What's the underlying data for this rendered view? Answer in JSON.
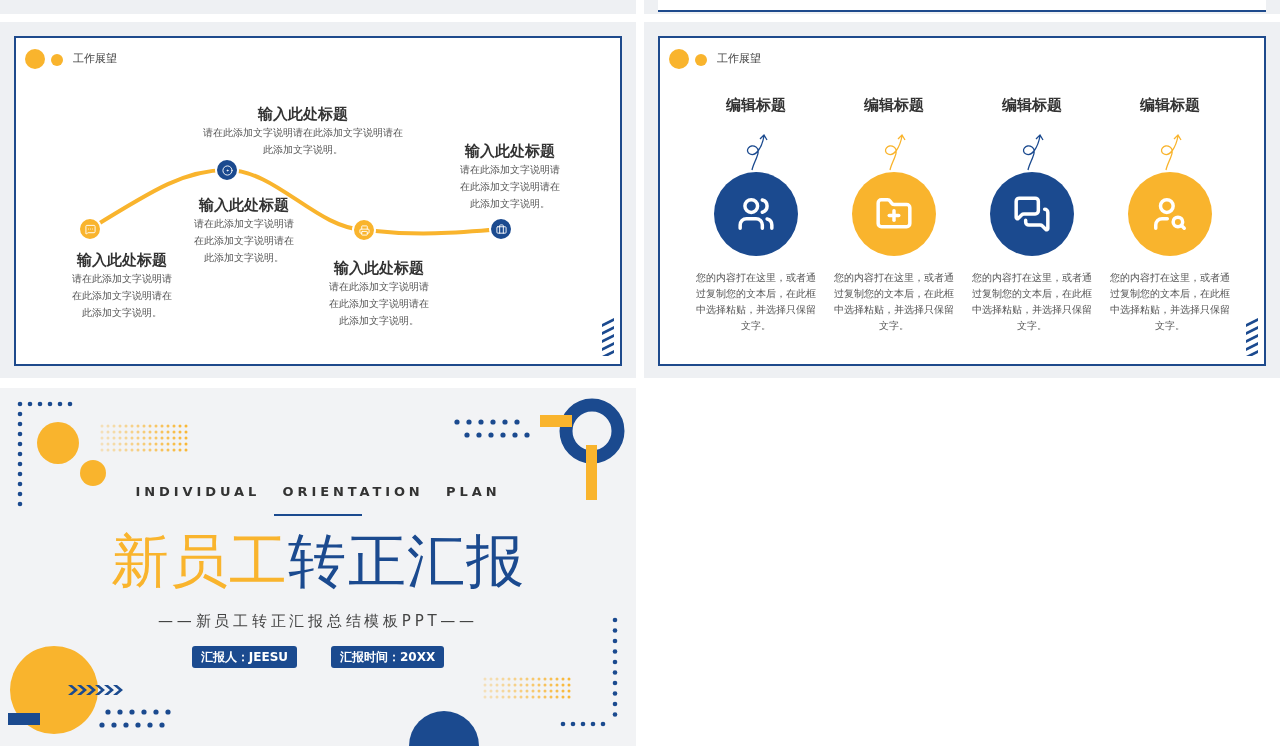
{
  "timeline_slide": {
    "header": "工作展望",
    "nodes": [
      {
        "color": "#f9b42d"
      },
      {
        "color": "#1b4a8f"
      },
      {
        "color": "#f9b42d"
      },
      {
        "color": "#1b4a8f"
      }
    ],
    "blocks": [
      {
        "title": "输入此处标题",
        "text": "请在此添加文字说明请在此添加文字说明请在此添加文字说明。"
      },
      {
        "title": "输入此处标题",
        "text": "请在此添加文字说明请在此添加文字说明请在此添加文字说明。"
      },
      {
        "title": "输入此处标题",
        "text": "请在此添加文字说明请在此添加文字说明请在此添加文字说明。"
      },
      {
        "title": "输入此处标题",
        "text": "请在此添加文字说明请在此添加文字说明请在此添加文字说明。"
      },
      {
        "title": "输入此处标题",
        "text": "请在此添加文字说明请在此添加文字说明请在此添加文字说明。"
      }
    ]
  },
  "feature_slide": {
    "header": "工作展望",
    "items": [
      {
        "title": "编辑标题",
        "text": "您的内容打在这里，或者通过复制您的文本后，在此框中选择粘贴，并选择只保留文字。",
        "color": "#1b4a8f"
      },
      {
        "title": "编辑标题",
        "text": "您的内容打在这里，或者通过复制您的文本后，在此框中选择粘贴，并选择只保留文字。",
        "color": "#f9b42d"
      },
      {
        "title": "编辑标题",
        "text": "您的内容打在这里，或者通过复制您的文本后，在此框中选择粘贴，并选择只保留文字。",
        "color": "#1b4a8f"
      },
      {
        "title": "编辑标题",
        "text": "您的内容打在这里，或者通过复制您的文本后，在此框中选择粘贴，并选择只保留文字。",
        "color": "#f9b42d"
      }
    ]
  },
  "cover_slide": {
    "kicker": "INDIVIDUAL ORIENTATION PLAN",
    "title": [
      {
        "text": "新员工",
        "color": "#f9b42d"
      },
      {
        "text": "转正汇报",
        "color": "#1b4a8f"
      }
    ],
    "subtitle": "——新员工转正汇报总结模板PPT——",
    "badges": [
      "汇报人：JEESU",
      "汇报时间：20XX"
    ]
  }
}
